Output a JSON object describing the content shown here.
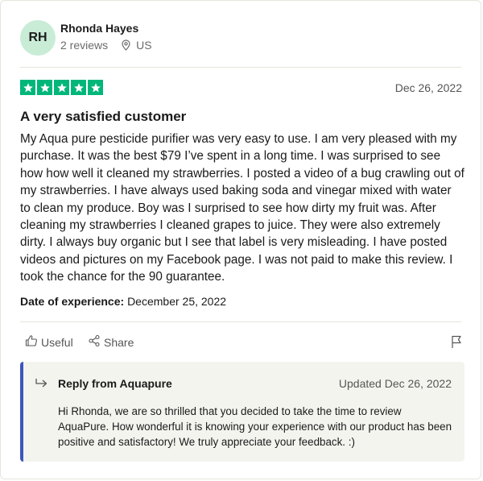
{
  "reviewer": {
    "initials": "RH",
    "name": "Rhonda Hayes",
    "reviews": "2 reviews",
    "country": "US"
  },
  "review": {
    "rating": 5,
    "date": "Dec 26, 2022",
    "title": "A very satisfied customer",
    "body": "My Aqua pure pesticide purifier was very easy to use. I am very pleased with my purchase. It was the best $79 I’ve spent in a long time. I was surprised to see how how well it cleaned my strawberries. I posted a video of a bug crawling out of my strawberries. I have always used baking soda and vinegar mixed with water to clean my produce. Boy was I surprised to see how dirty my fruit was. After cleaning my strawberries I cleaned grapes to juice. They were also extremely dirty. I always buy organic but I see that label is very misleading. I have posted videos and pictures on my Facebook page. I was not paid to make this review. I took the chance for the 90 guarantee.",
    "experience_label": "Date of experience:",
    "experience_date": "December 25, 2022"
  },
  "actions": {
    "useful_label": "Useful",
    "share_label": "Share"
  },
  "reply": {
    "title": "Reply from Aquapure",
    "date": "Updated Dec 26, 2022",
    "body": "Hi Rhonda, we are so thrilled that you decided to take the time to review AquaPure. How wonderful it is knowing your experience with our product has been positive and satisfactory! We truly appreciate your feedback. :)"
  },
  "colors": {
    "star": "#00b67a",
    "avatar_bg": "#c9ecd6",
    "reply_accent": "#3c57bc",
    "reply_bg": "#f4f4ef"
  },
  "icons": [
    "location-pin-icon",
    "star-icon",
    "thumbs-up-icon",
    "share-icon",
    "flag-icon",
    "reply-arrow-icon"
  ]
}
